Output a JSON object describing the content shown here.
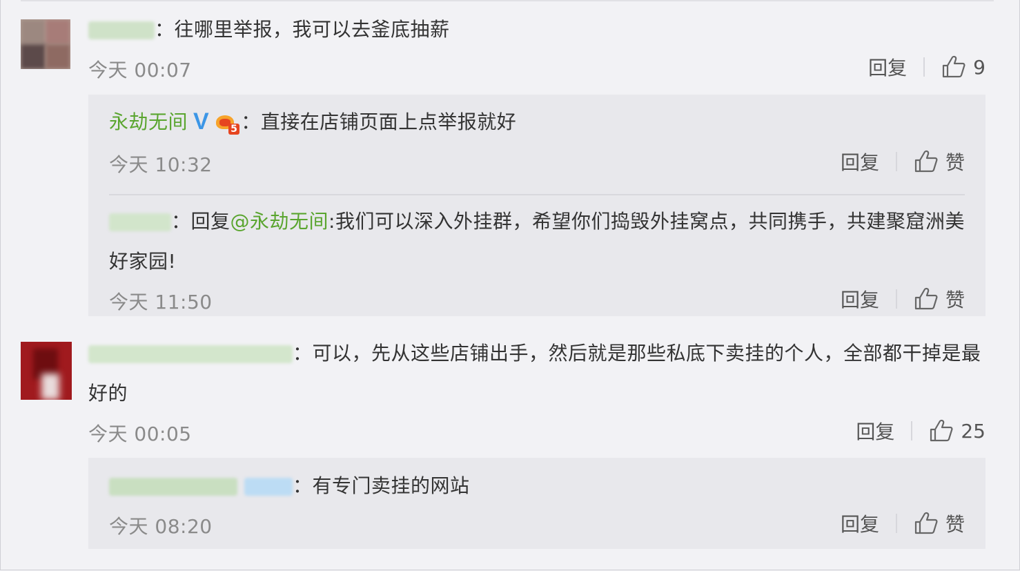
{
  "labels": {
    "reply": "回复",
    "like_word": "赞",
    "sep": "："
  },
  "comments": [
    {
      "text": "往哪里举报，我可以去釜底抽薪",
      "time": "今天 00:07",
      "likes": "9",
      "replies": [
        {
          "user": "永劫无间",
          "verified": true,
          "vip_level": "5",
          "text": "直接在店铺页面上点举报就好",
          "time": "今天 10:32",
          "likes": "赞"
        },
        {
          "reply_prefix": "回复",
          "mention": "@永劫无间",
          "text": ":我们可以深入外挂群，希望你们捣毁外挂窝点，共同携手，共建聚窟洲美好家园!",
          "time": "今天 11:50",
          "likes": "赞"
        }
      ]
    },
    {
      "text": "可以，先从这些店铺出手，然后就是那些私底下卖挂的个人，全部都干掉是最好的",
      "time": "今天 00:05",
      "likes": "25",
      "replies": [
        {
          "text": "有专门卖挂的网站",
          "time": "今天 08:20",
          "likes": "赞"
        }
      ]
    }
  ],
  "colors": {
    "username_green": "#5aa52f",
    "mention_orange": "#eb7350",
    "verified_blue": "#3c96e6",
    "time_gray": "#8a8a8a"
  },
  "icons": [
    "thumbs-up-icon",
    "verified-v-icon",
    "vip-crown-icon"
  ]
}
